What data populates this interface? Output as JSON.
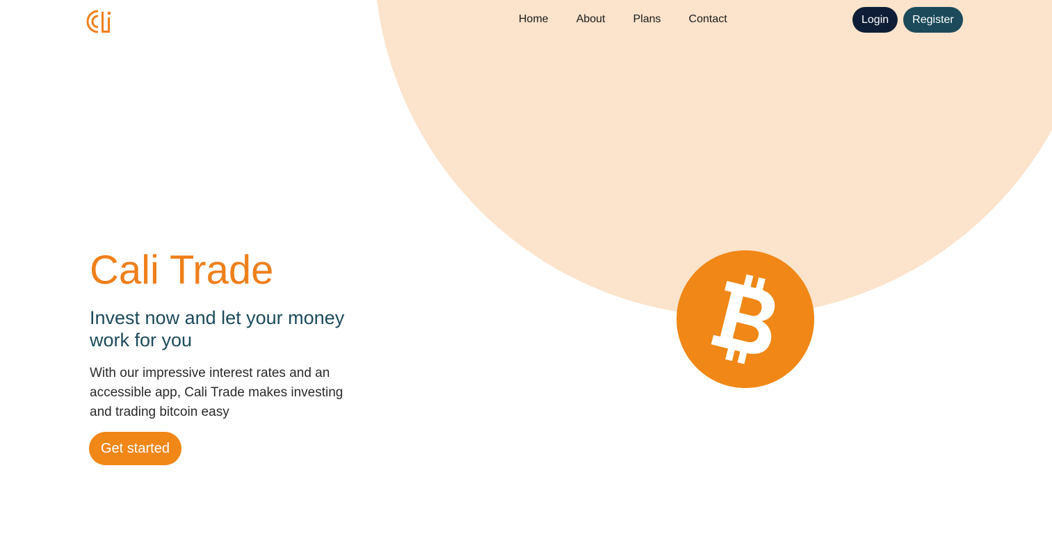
{
  "brand": {
    "logo_icon": "cali-logo-icon",
    "primary_color": "#ef7f1a",
    "dark_color": "#0f1e36",
    "teal_color": "#1c4a5a",
    "peach_color": "#fce3cb"
  },
  "nav": {
    "items": [
      {
        "label": "Home"
      },
      {
        "label": "About"
      },
      {
        "label": "Plans"
      },
      {
        "label": "Contact"
      }
    ]
  },
  "auth": {
    "login_label": "Login",
    "register_label": "Register"
  },
  "hero": {
    "title": "Cali Trade",
    "subtitle": "Invest now and let your money work for you",
    "description": "With our impressive interest rates and an accessible app, Cali Trade makes investing and trading bitcoin easy",
    "cta_label": "Get started",
    "illustration_icon": "bitcoin-icon"
  }
}
